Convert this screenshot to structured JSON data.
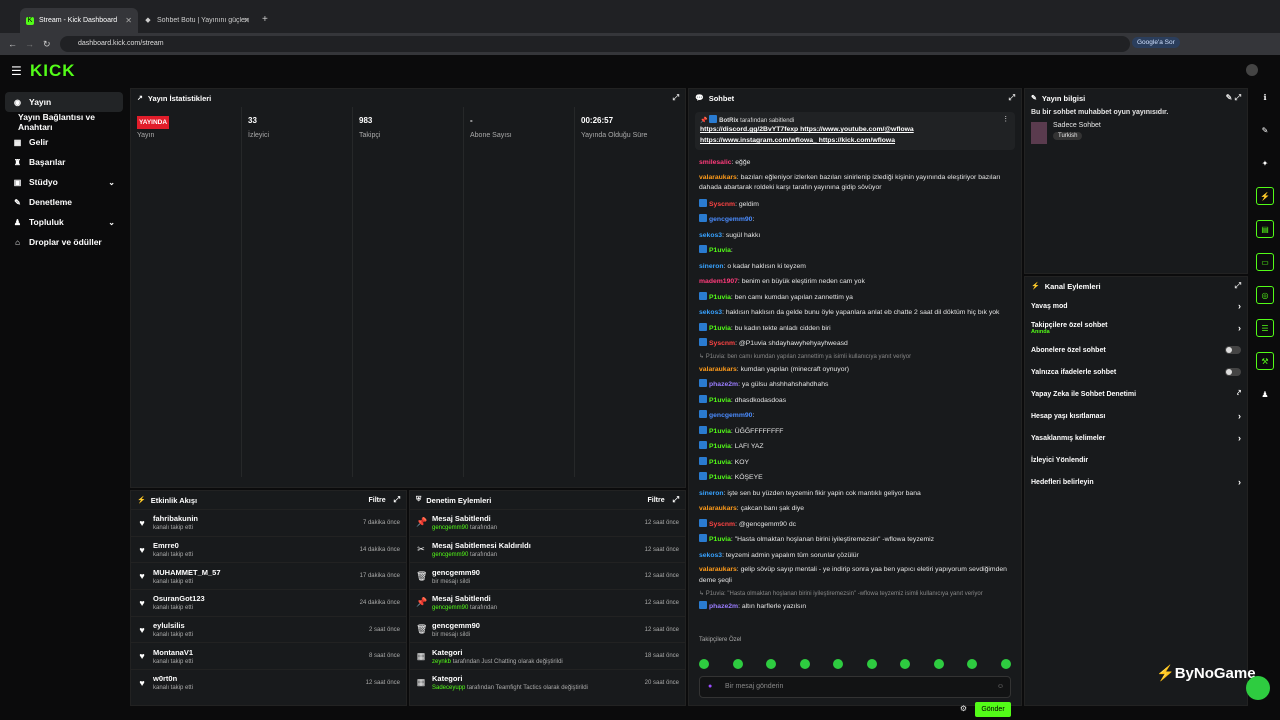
{
  "browser": {
    "tab1": "Stream - Kick Dashboard",
    "tab2": "Sohbet Botu | Yayınını güçlendir",
    "url": "dashboard.kick.com/stream",
    "google": "Google'a Sor"
  },
  "logo": "KICK",
  "nav": [
    {
      "label": "Yayın"
    },
    {
      "label": "Yayın Bağlantısı ve Anahtarı"
    },
    {
      "label": "Gelir"
    },
    {
      "label": "Başarılar"
    },
    {
      "label": "Stüdyo"
    },
    {
      "label": "Denetleme"
    },
    {
      "label": "Topluluk"
    },
    {
      "label": "Droplar ve ödüller"
    }
  ],
  "stats": {
    "title": "Yayın İstatistikleri",
    "live": "YAYINDA",
    "live_label": "Yayın",
    "viewers": "33",
    "viewers_label": "İzleyici",
    "followers": "983",
    "followers_label": "Takipçi",
    "subs": "-",
    "subs_label": "Abone Sayısı",
    "time": "00:26:57",
    "time_label": "Yayında Olduğu Süre"
  },
  "activity": {
    "title": "Etkinlik Akışı",
    "filter": "Filtre",
    "rows": [
      {
        "name": "fahribakunin",
        "sub": "kanalı takip etti",
        "time": "7 dakika önce"
      },
      {
        "name": "Emrre0",
        "sub": "kanalı takip etti",
        "time": "14 dakika önce"
      },
      {
        "name": "MUHAMMET_M_57",
        "sub": "kanalı takip etti",
        "time": "17 dakika önce"
      },
      {
        "name": "OsuranGot123",
        "sub": "kanalı takip etti",
        "time": "24 dakika önce"
      },
      {
        "name": "eylulsilis",
        "sub": "kanalı takip etti",
        "time": "2 saat önce"
      },
      {
        "name": "MontanaV1",
        "sub": "kanalı takip etti",
        "time": "8 saat önce"
      },
      {
        "name": "w0rt0n",
        "sub": "kanalı takip etti",
        "time": "12 saat önce"
      }
    ]
  },
  "moderation": {
    "title": "Denetim Eylemleri",
    "filter": "Filtre",
    "rows": [
      {
        "name": "Mesaj Sabitlendi",
        "u": "gencgemm90",
        "sub": "tarafından",
        "time": "12 saat önce"
      },
      {
        "name": "Mesaj Sabitlemesi Kaldırıldı",
        "u": "gencgemm90",
        "sub": "tarafından",
        "time": "12 saat önce"
      },
      {
        "name": "gencgemm90",
        "u": "",
        "sub": "bir mesajı sildi",
        "time": "12 saat önce"
      },
      {
        "name": "Mesaj Sabitlendi",
        "u": "gencgemm90",
        "sub": "tarafından",
        "time": "12 saat önce"
      },
      {
        "name": "gencgemm90",
        "u": "",
        "sub": "bir mesajı sildi",
        "time": "12 saat önce"
      },
      {
        "name": "Kategori",
        "u": "zeynkb",
        "sub": "tarafından Just Chatting olarak değiştirildi",
        "time": "18 saat önce"
      },
      {
        "name": "Kategori",
        "u": "Sadeceyupp",
        "sub": "tarafından Teamfight Tactics olarak değiştirildi",
        "time": "20 saat önce"
      }
    ]
  },
  "chat": {
    "title": "Sohbet",
    "pin_by": "BotRix",
    "pin_suffix": "tarafından sabitlendi",
    "pin_l1": "https://discord.gg/2BvYT7fexp https://www.youtube.com/@wflowa",
    "pin_l2": "https://www.instagram.com/wflowa_ https://kick.com/wflowa",
    "messages": [
      {
        "n": "smilesalic",
        "c": "c1",
        "t": "eğğe"
      },
      {
        "n": "valaraukars",
        "c": "c2",
        "t": "bazıları eğleniyor izlerken bazıları sinirlenip izlediği kişinin yayınında eleştiriyor bazıları dahada abartarak roldeki karşı tarafın yayınına gidip sövüyor",
        "w": 1
      },
      {
        "n": "Syscnm",
        "c": "c5",
        "t": "geldim",
        "b": 1
      },
      {
        "n": "gencgemm90",
        "c": "c3",
        "t": "",
        "b": 1
      },
      {
        "n": "sekos3",
        "c": "c7",
        "t": "sugül hakkı"
      },
      {
        "n": "P1uvia",
        "c": "c6",
        "t": "",
        "b": 1
      },
      {
        "n": "sineron",
        "c": "c7",
        "t": "o kadar haklısın ki teyzem"
      },
      {
        "n": "madem1907",
        "c": "c1",
        "t": "benim en büyük eleştirim neden cam yok"
      },
      {
        "n": "P1uvia",
        "c": "c6",
        "t": "ben camı kumdan yapılan zannettim ya",
        "b": 1
      },
      {
        "n": "sekos3",
        "c": "c7",
        "t": "haklısın haklısın da gelde bunu öyle yapanlara anlat eb chatte 2 saat dil döktüm hiç bık yok"
      },
      {
        "n": "P1uvia",
        "c": "c6",
        "t": "bu kadın tekte anladı cidden biri",
        "b": 1
      },
      {
        "n": "Syscnm",
        "c": "c5",
        "t": "@P1uvia shdayhawyhehyayhweasd",
        "b": 1
      },
      {
        "r": "P1uvia: ben camı kumdan yapılan zannettim ya isimli kullanıcıya yanıt veriyor"
      },
      {
        "n": "valaraukars",
        "c": "c2",
        "t": "kumdan yapılan (minecraft oynuyor)"
      },
      {
        "n": "phaze2m",
        "c": "c4",
        "t": "ya gülsu ahshhahshahdhahs",
        "b": 1
      },
      {
        "n": "P1uvia",
        "c": "c6",
        "t": "dhasdkodasdoas",
        "b": 1
      },
      {
        "n": "gencgemm90",
        "c": "c3",
        "t": "",
        "b": 1
      },
      {
        "n": "P1uvia",
        "c": "c6",
        "t": "ÜĞĞFFFFFFFF",
        "b": 1
      },
      {
        "n": "P1uvia",
        "c": "c6",
        "t": "LAFI YAZ",
        "b": 1
      },
      {
        "n": "P1uvia",
        "c": "c6",
        "t": "KOY",
        "b": 1
      },
      {
        "n": "P1uvia",
        "c": "c6",
        "t": "KÖŞEYE",
        "b": 1
      },
      {
        "n": "sineron",
        "c": "c7",
        "t": "işte sen bu yüzden teyzemin fikir yapin cok mantıklı geliyor bana"
      },
      {
        "n": "valaraukars",
        "c": "c2",
        "t": "çakcan banı şak diye"
      },
      {
        "n": "Syscnm",
        "c": "c5",
        "t": "@gencgemm90 dc",
        "b": 1
      },
      {
        "n": "P1uvia",
        "c": "c6",
        "t": "\"Hasta olmaktan hoşlanan birini iyileştiremezsin\" -wflowa teyzemiz",
        "b": 1
      },
      {
        "n": "sekos3",
        "c": "c7",
        "t": "teyzemi admin yapalım tüm sorunlar çözülür"
      },
      {
        "n": "valaraukars",
        "c": "c2",
        "t": "gelip sövüp sayıp mentali - ye indirip sonra yaa ben yapıcı eletiri yapıyorum sevdiğimden deme şeqli",
        "w": 1
      },
      {
        "r": "P1uvia: \"Hasta olmaktan hoşlanan birini iyileştiremezsin\" -wflowa teyzemiz isimli kullanıcıya yanıt veriyor"
      },
      {
        "n": "phaze2m",
        "c": "c4",
        "t": "altın harflerle yazılsın",
        "b": 1
      },
      {
        "n": "P1uvia",
        "c": "c6",
        "t": "lavuksal hareket kısaca",
        "b": 1
      }
    ],
    "followers_only": "Takipçilere Özel",
    "placeholder": "Bir mesaj gönderin",
    "send": "Gönder"
  },
  "info": {
    "title": "Yayın bilgisi",
    "desc": "Bu bir sohbet muhabbet oyun yayınısıdır.",
    "category": "Sadece Sohbet",
    "lang": "Turkish"
  },
  "actions": {
    "title": "Kanal Eylemleri",
    "items": [
      {
        "label": "Yavaş mod",
        "type": "arrow"
      },
      {
        "label": "Takipçilere özel sohbet",
        "sub": "Anında",
        "type": "arrow"
      },
      {
        "label": "Abonelere özel sohbet",
        "type": "toggle"
      },
      {
        "label": "Yalnızca ifadelerle sohbet",
        "type": "toggle"
      },
      {
        "label": "Yapay Zeka ile Sohbet Denetimi",
        "type": "ext"
      },
      {
        "label": "Hesap yaşı kısıtlaması",
        "type": "arrow"
      },
      {
        "label": "Yasaklanmış kelimeler",
        "type": "arrow"
      },
      {
        "label": "İzleyici Yönlendir",
        "type": "none"
      },
      {
        "label": "Hedefleri belirleyin",
        "type": "arrow"
      }
    ]
  },
  "watermark": "ByNoGame"
}
